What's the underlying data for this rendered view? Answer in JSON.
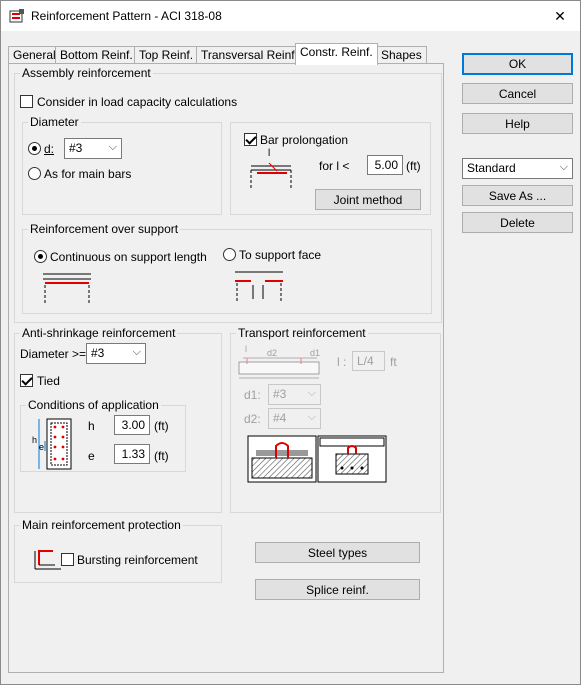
{
  "window": {
    "title": "Reinforcement Pattern - ACI 318-08",
    "close": "✕"
  },
  "tabs": [
    "General",
    "Bottom Reinf.",
    "Top Reinf.",
    "Transversal Reinf.",
    "Constr. Reinf.",
    "Shapes"
  ],
  "assembly": {
    "title": "Assembly reinforcement",
    "consider_label": "Consider in load capacity calculations",
    "diameter": {
      "title": "Diameter",
      "d_label": "d:",
      "d_value": "#3",
      "as_main_label": "As for main bars"
    },
    "prolongation": {
      "bar_label": "Bar prolongation",
      "l_label": "l",
      "for_label": "for l <",
      "value": "5.00",
      "unit": "(ft)",
      "joint_button": "Joint method"
    },
    "support": {
      "title": "Reinforcement over support",
      "continuous_label": "Continuous on support length",
      "face_label": "To support face"
    }
  },
  "anti_shrinkage": {
    "title": "Anti-shrinkage reinforcement",
    "diameter_label": "Diameter >=",
    "diameter_value": "#3",
    "tied_label": "Tied",
    "conditions": {
      "title": "Conditions of application",
      "h_label": "h",
      "h_value": "3.00",
      "h_unit": "(ft)",
      "e_label": "e",
      "e_value": "1.33",
      "e_unit": "(ft)",
      "fig_h": "h",
      "fig_e": "e"
    }
  },
  "transport": {
    "title": "Transport reinforcement",
    "fig_l": "l",
    "fig_d2": "d2",
    "fig_d1": "d1",
    "l_label": "l :",
    "l_value": "L/4",
    "l_unit": "ft",
    "d1_label": "d1:",
    "d1_value": "#3",
    "d2_label": "d2:",
    "d2_value": "#4"
  },
  "protection": {
    "title": "Main reinforcement protection",
    "bursting_label": "Bursting reinforcement"
  },
  "buttons": {
    "steel_types": "Steel types",
    "splice": "Splice reinf.",
    "ok": "OK",
    "cancel": "Cancel",
    "help": "Help",
    "preset_value": "Standard",
    "save_as": "Save As ...",
    "delete": "Delete"
  },
  "colors": {
    "accent": "#0078d7",
    "rebar_red": "#e00000"
  }
}
